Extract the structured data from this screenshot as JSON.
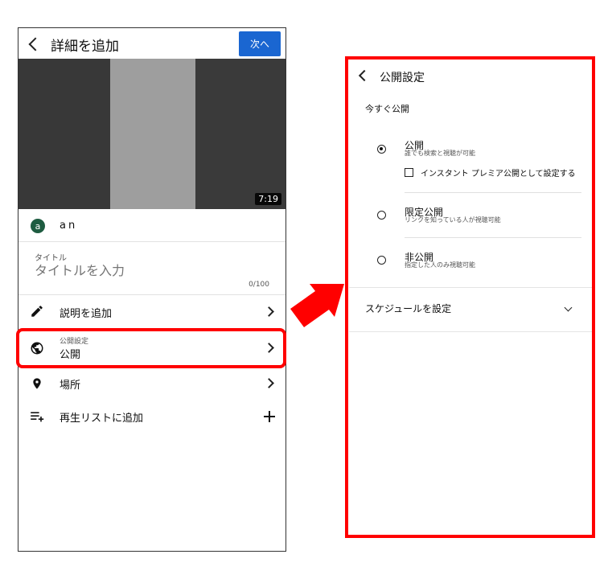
{
  "left": {
    "header": {
      "title": "詳細を追加",
      "next_label": "次へ"
    },
    "video": {
      "duration": "7:19"
    },
    "channel": {
      "avatar_letter": "a",
      "name": "an"
    },
    "title_field": {
      "label": "タイトル",
      "placeholder": "タイトルを入力",
      "count": "0/100"
    },
    "rows": {
      "description": "説明を追加",
      "visibility_caption": "公開設定",
      "visibility_value": "公開",
      "location": "場所",
      "playlist": "再生リストに追加"
    }
  },
  "right": {
    "header": {
      "title": "公開設定"
    },
    "section": "今すぐ公開",
    "options": [
      {
        "title": "公開",
        "desc": "誰でも検索と視聴が可能",
        "selected": true
      },
      {
        "title": "限定公開",
        "desc": "リンクを知っている人が視聴可能",
        "selected": false
      },
      {
        "title": "非公開",
        "desc": "指定した人のみ視聴可能",
        "selected": false
      }
    ],
    "premiere_checkbox": "インスタント プレミア公開として設定する",
    "schedule": "スケジュールを設定"
  },
  "colors": {
    "accent_blue": "#1a66d1",
    "highlight_red": "#ff0000",
    "avatar_green": "#1e5c41"
  },
  "icons": [
    "back-icon",
    "pencil-icon",
    "globe-icon",
    "location-pin-icon",
    "playlist-add-icon",
    "plus-icon",
    "chevron-right-icon",
    "chevron-down-icon"
  ]
}
